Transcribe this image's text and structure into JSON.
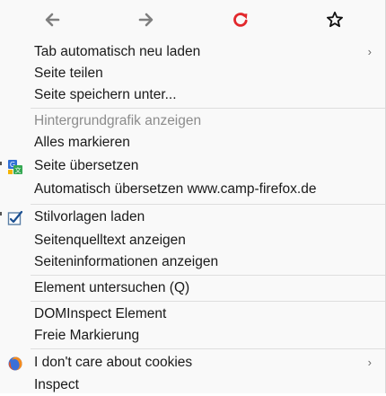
{
  "nav": {
    "back_icon": "arrow-left-icon",
    "forward_icon": "arrow-right-icon",
    "reload_icon": "reload-icon",
    "bookmark_icon": "star-icon",
    "reload_color": "#e2282c",
    "arrow_color": "#7f7f7f"
  },
  "menu": {
    "items": [
      {
        "label": "Tab automatisch neu laden",
        "has_submenu": true
      },
      {
        "label": "Seite teilen"
      },
      {
        "label": "Seite speichern unter..."
      },
      {
        "label": "Hintergrundgrafik anzeigen",
        "disabled": true
      },
      {
        "label": "Alles markieren"
      },
      {
        "label": "Seite übersetzen",
        "icon": "translate-icon"
      },
      {
        "label": "Automatisch übersetzen www.camp-firefox.de"
      },
      {
        "label": "Stilvorlagen laden",
        "icon": "style-checkbox-icon"
      },
      {
        "label": "Seitenquelltext anzeigen"
      },
      {
        "label": "Seiteninformationen anzeigen"
      },
      {
        "label": "Element untersuchen (Q)"
      },
      {
        "label": "DOMInspect Element"
      },
      {
        "label": "Freie Markierung"
      },
      {
        "label": "I don't care about cookies",
        "icon": "firefox-extension-icon",
        "has_submenu": true
      },
      {
        "label": "Inspect"
      }
    ],
    "submenu_arrow": "›"
  }
}
